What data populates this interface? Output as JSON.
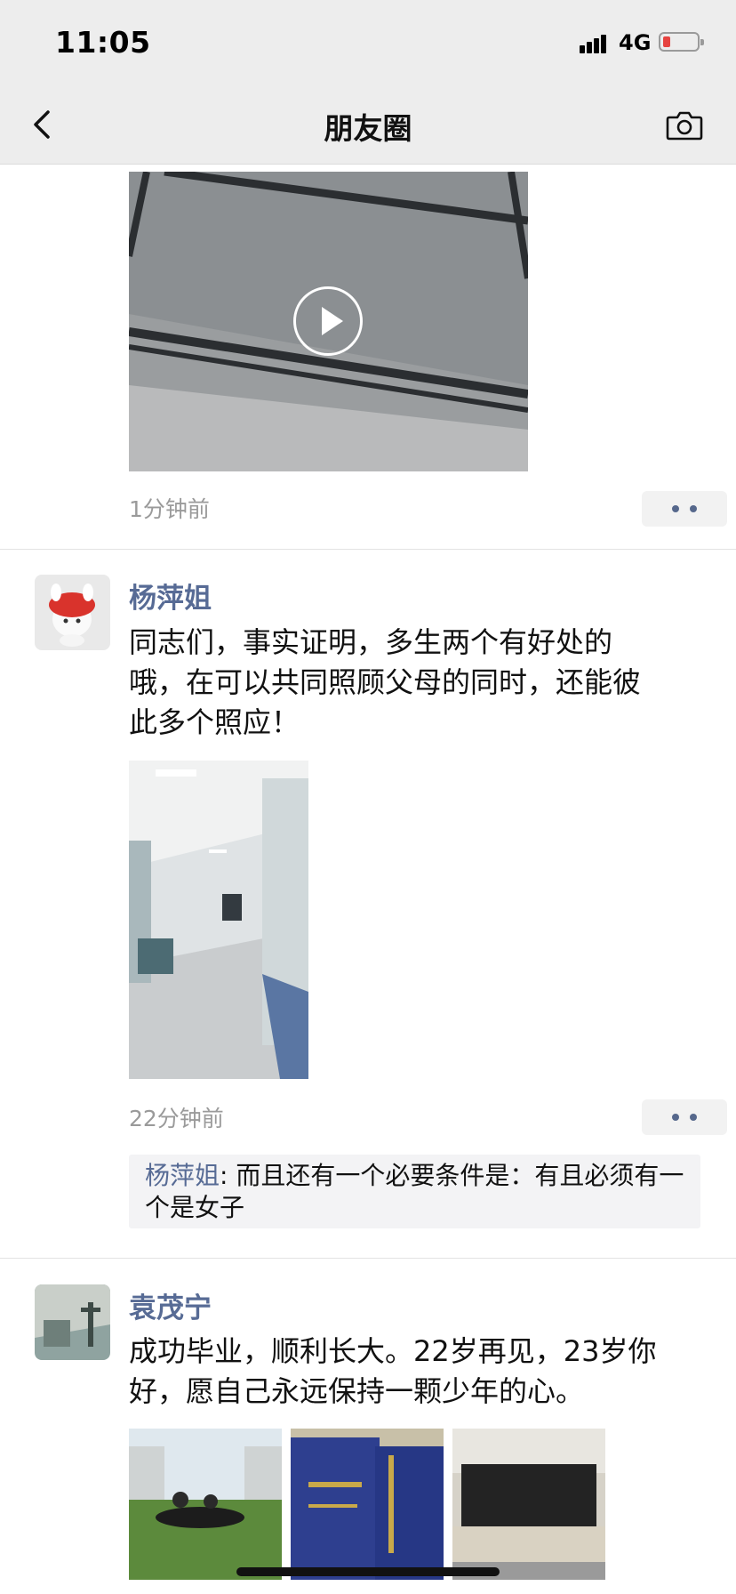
{
  "status_bar": {
    "time": "11:05",
    "network": "4G",
    "battery_color": "#e64340"
  },
  "nav": {
    "title": "朋友圈",
    "back_icon": "chevron-left-icon",
    "camera_icon": "camera-icon"
  },
  "colors": {
    "username": "#576b95",
    "timestamp": "#9a9a9a",
    "header_bg": "#ededed"
  },
  "posts": [
    {
      "timestamp": "1分钟前",
      "media": "video"
    },
    {
      "user": "杨萍姐",
      "text_lines": [
        "同志们，事实证明，多生两个有好处的",
        "哦，在可以共同照顾父母的同时，还能彼",
        "此多个照应！"
      ],
      "timestamp": "22分钟前",
      "comments": [
        {
          "user": "杨萍姐",
          "text": ": 而且还有一个必要条件是：有且必须有一个是女子"
        }
      ]
    },
    {
      "user": "袁茂宁",
      "text_lines": [
        "成功毕业，顺利长大。22岁再见，23岁你",
        "好，愿自己永远保持一颗少年的心。"
      ]
    }
  ]
}
